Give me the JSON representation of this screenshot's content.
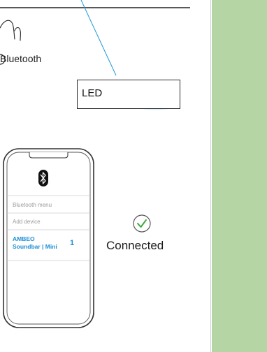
{
  "speaker": {
    "bluetooth_label": "Bluetooth"
  },
  "led": {
    "label": "LED",
    "indicator_color": "#3aa0e8"
  },
  "phone": {
    "menu_title": "Bluetooth menu",
    "add_device": "Add device",
    "device_name_line1": "AMBEO",
    "device_name_line2": "Soundbar | Mini",
    "step_number": "1",
    "accent_color": "#1f8fd6"
  },
  "status": {
    "connected_label": "Connected",
    "check_color": "#3aaa3a"
  },
  "colors": {
    "side_panel": "#b5d5a4",
    "callout_line": "#1f9ad6"
  }
}
